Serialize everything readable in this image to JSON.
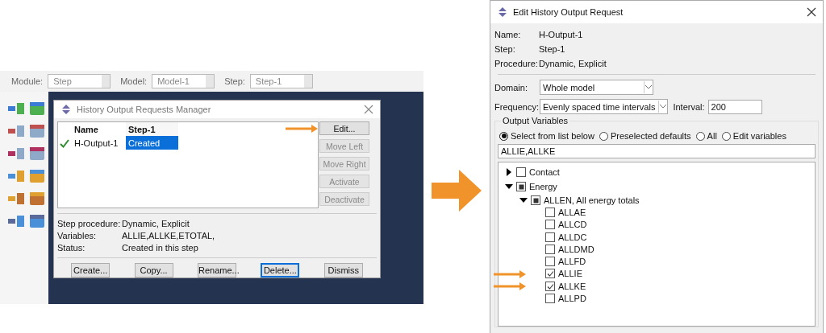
{
  "toolbar": [
    {
      "label": "Module:",
      "value": "Step"
    },
    {
      "label": "Model:",
      "value": "Model-1"
    },
    {
      "label": "Step:",
      "value": "Step-1"
    }
  ],
  "manager": {
    "title": "History Output Requests Manager",
    "columns": [
      "Name",
      "Step-1"
    ],
    "rows": [
      {
        "active": true,
        "name": "H-Output-1",
        "status": "Created",
        "selected": true
      }
    ],
    "side_buttons": [
      {
        "label": "Edit...",
        "disabled": false,
        "highlighted": true
      },
      {
        "label": "Move Left",
        "disabled": true,
        "highlighted": false
      },
      {
        "label": "Move Right",
        "disabled": true,
        "highlighted": false
      },
      {
        "label": "Activate",
        "disabled": true,
        "highlighted": false
      },
      {
        "label": "Deactivate",
        "disabled": true,
        "highlighted": false
      }
    ],
    "info": [
      {
        "label": "Step procedure:",
        "value": "Dynamic, Explicit"
      },
      {
        "label": "Variables:",
        "value": "ALLIE,ALLKE,ETOTAL,"
      },
      {
        "label": "Status:",
        "value": "Created in this step"
      }
    ],
    "buttons": [
      {
        "label": "Create...",
        "focused": false
      },
      {
        "label": "Copy...",
        "focused": false
      },
      {
        "label": "Rename...",
        "focused": false
      },
      {
        "label": "Delete...",
        "focused": true
      },
      {
        "label": "Dismiss",
        "focused": false
      }
    ]
  },
  "editor": {
    "title": "Edit History Output Request",
    "info": [
      {
        "label": "Name:",
        "value": "H-Output-1"
      },
      {
        "label": "Step:",
        "value": "Step-1"
      },
      {
        "label": "Procedure:",
        "value": "Dynamic, Explicit"
      }
    ],
    "domain": {
      "label": "Domain:",
      "value": "Whole model"
    },
    "frequency": {
      "label": "Frequency:",
      "value": "Evenly spaced time intervals"
    },
    "interval": {
      "label": "Interval:",
      "value": "200"
    },
    "output_variables": {
      "title": "Output Variables",
      "options": [
        {
          "label": "Select from list below",
          "selected": true
        },
        {
          "label": "Preselected defaults",
          "selected": false
        },
        {
          "label": "All",
          "selected": false
        },
        {
          "label": "Edit variables",
          "selected": false
        }
      ],
      "text": "ALLIE,ALLKE",
      "tree": [
        {
          "label": "Contact",
          "expanded": false,
          "partial": false
        },
        {
          "label": "Energy",
          "expanded": true,
          "partial": true,
          "children": [
            {
              "label": "ALLEN, All energy totals",
              "expanded": true,
              "partial": true,
              "children": [
                {
                  "label": "ALLAE",
                  "checked": false,
                  "highlighted": false
                },
                {
                  "label": "ALLCD",
                  "checked": false,
                  "highlighted": false
                },
                {
                  "label": "ALLDC",
                  "checked": false,
                  "highlighted": false
                },
                {
                  "label": "ALLDMD",
                  "checked": false,
                  "highlighted": false
                },
                {
                  "label": "ALLFD",
                  "checked": false,
                  "highlighted": false
                },
                {
                  "label": "ALLIE",
                  "checked": true,
                  "highlighted": true
                },
                {
                  "label": "ALLKE",
                  "checked": true,
                  "highlighted": true
                },
                {
                  "label": "ALLPD",
                  "checked": false,
                  "highlighted": false
                }
              ]
            }
          ]
        }
      ]
    }
  }
}
